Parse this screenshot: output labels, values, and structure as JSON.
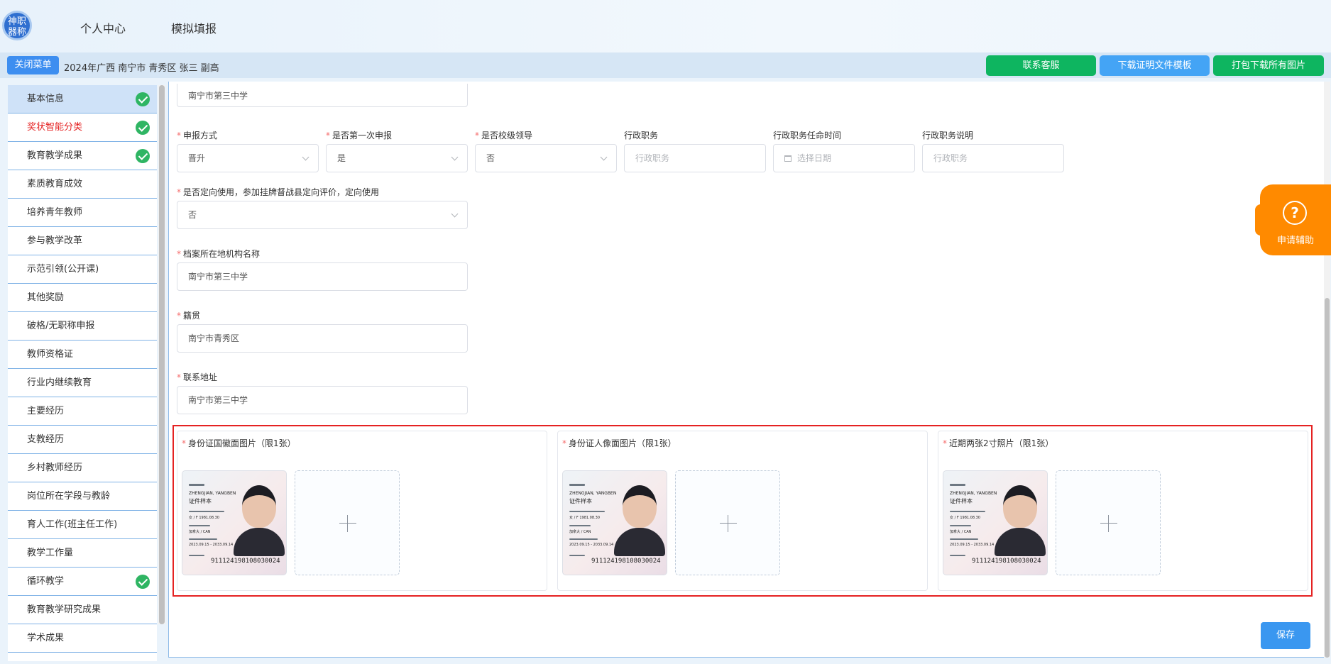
{
  "header": {
    "logo_text": "神职\n器称",
    "nav": [
      "个人中心",
      "模拟填报"
    ]
  },
  "toolbar": {
    "close_menu": "关闭菜单",
    "context": "2024年广西 南宁市 青秀区 张三 副高",
    "buttons": [
      {
        "label": "联系客服",
        "color": "#0eb560"
      },
      {
        "label": "下载证明文件模板",
        "color": "#44a4f5"
      },
      {
        "label": "打包下载所有图片",
        "color": "#0eb560"
      }
    ]
  },
  "sidebar": {
    "items": [
      {
        "label": "基本信息",
        "done": true,
        "active": true
      },
      {
        "label": "奖状智能分类",
        "done": true,
        "red": true
      },
      {
        "label": "教育教学成果",
        "done": true
      },
      {
        "label": "素质教育成效",
        "done": false
      },
      {
        "label": "培养青年教师",
        "done": false
      },
      {
        "label": "参与教学改革",
        "done": false
      },
      {
        "label": "示范引领(公开课)",
        "done": false
      },
      {
        "label": "其他奖励",
        "done": false
      },
      {
        "label": "破格/无职称申报",
        "done": false
      },
      {
        "label": "教师资格证",
        "done": false
      },
      {
        "label": "行业内继续教育",
        "done": false
      },
      {
        "label": "主要经历",
        "done": false
      },
      {
        "label": "支教经历",
        "done": false
      },
      {
        "label": "乡村教师经历",
        "done": false
      },
      {
        "label": "岗位所在学段与教龄",
        "done": false
      },
      {
        "label": "育人工作(班主任工作)",
        "done": false
      },
      {
        "label": "教学工作量",
        "done": false
      },
      {
        "label": "循环教学",
        "done": true
      },
      {
        "label": "教育教学研究成果",
        "done": false
      },
      {
        "label": "学术成果",
        "done": false
      }
    ]
  },
  "form": {
    "top_value": "南宁市第三中学",
    "row1": [
      {
        "label": "申报方式",
        "required": true,
        "value": "晋升",
        "select": true
      },
      {
        "label": "是否第一次申报",
        "required": true,
        "value": "是",
        "select": true
      },
      {
        "label": "是否校级领导",
        "required": true,
        "value": "否",
        "select": true
      },
      {
        "label": "行政职务",
        "required": false,
        "placeholder": "行政职务"
      },
      {
        "label": "行政职务任命时间",
        "required": false,
        "placeholder": "选择日期",
        "date": true
      },
      {
        "label": "行政职务说明",
        "required": false,
        "placeholder": "行政职务"
      }
    ],
    "targeted": {
      "label": "是否定向使用，参加挂牌督战县定向评价，定向使用",
      "value": "否"
    },
    "archive": {
      "label": "档案所在地机构名称",
      "value": "南宁市第三中学"
    },
    "native": {
      "label": "籍贯",
      "value": "南宁市青秀区"
    },
    "address": {
      "label": "联系地址",
      "value": "南宁市第三中学"
    }
  },
  "uploads": [
    {
      "label": "身份证国徽面图片（限1张）"
    },
    {
      "label": "身份证人像面图片（限1张）"
    },
    {
      "label": "近期两张2寸照片（限1张）"
    }
  ],
  "id_card": {
    "name": "ZHENGJIAN, YANGBEN",
    "chinese": "证件样本",
    "sex_dob": "女 / F   1981.08.30",
    "nation": "加拿大 / CAN",
    "validity": "2023.09.15 - 2033.09.14",
    "number": "911124198108030024"
  },
  "save_label": "保存",
  "help_label": "申请辅助"
}
